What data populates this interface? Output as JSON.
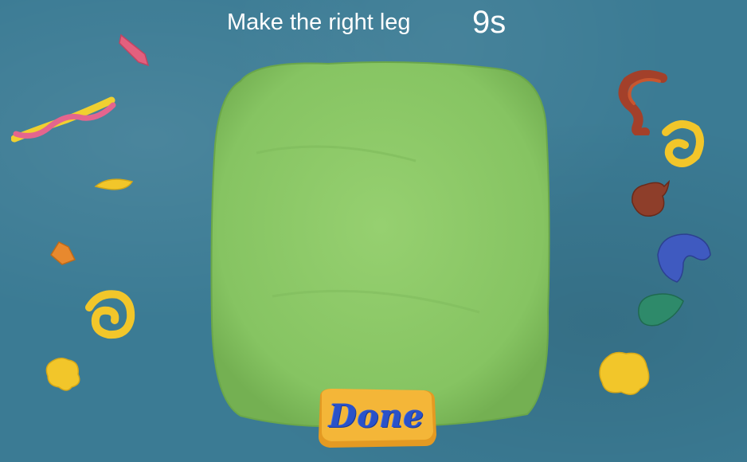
{
  "header": {
    "instruction": "Make the right leg",
    "timer": "9s"
  },
  "actions": {
    "done_label": "Done"
  },
  "colors": {
    "background": "#3b7b94",
    "dough": "#8cc96a",
    "done_button": "#f2b030",
    "done_text": "#2a52c9"
  },
  "pieces": {
    "left": [
      "pink-diamond",
      "pink-yellow-twist",
      "yellow-leaf",
      "orange-chunk",
      "yellow-spiral",
      "yellow-blob"
    ],
    "right": [
      "brown-red-coil",
      "yellow-spiral",
      "brown-cone",
      "blue-crescent",
      "teal-drop",
      "yellow-blob"
    ]
  }
}
